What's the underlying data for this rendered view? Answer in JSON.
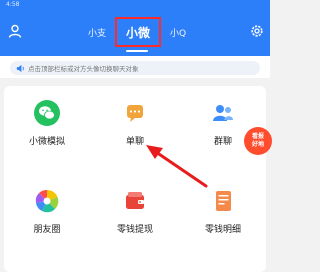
{
  "status": {
    "time": "4:58"
  },
  "header": {
    "tabs": {
      "left": "小支",
      "center": "小微",
      "right": "小Q"
    }
  },
  "notice": {
    "text": "点击顶部栏标或对方头像切换聊天对象"
  },
  "grid": {
    "items": [
      {
        "label": "小微模拟",
        "icon": "wechat-icon"
      },
      {
        "label": "单聊",
        "icon": "single-chat-icon"
      },
      {
        "label": "群聊",
        "icon": "group-chat-icon"
      },
      {
        "label": "朋友圈",
        "icon": "moments-icon"
      },
      {
        "label": "零钱提现",
        "icon": "wallet-icon"
      },
      {
        "label": "零钱明细",
        "icon": "ledger-icon"
      }
    ]
  },
  "badge": {
    "line1": "看报",
    "line2": "好地"
  },
  "colors": {
    "header": "#2d7ff9",
    "highlight": "#ff2a2a",
    "badge": "#ff4d2e"
  }
}
